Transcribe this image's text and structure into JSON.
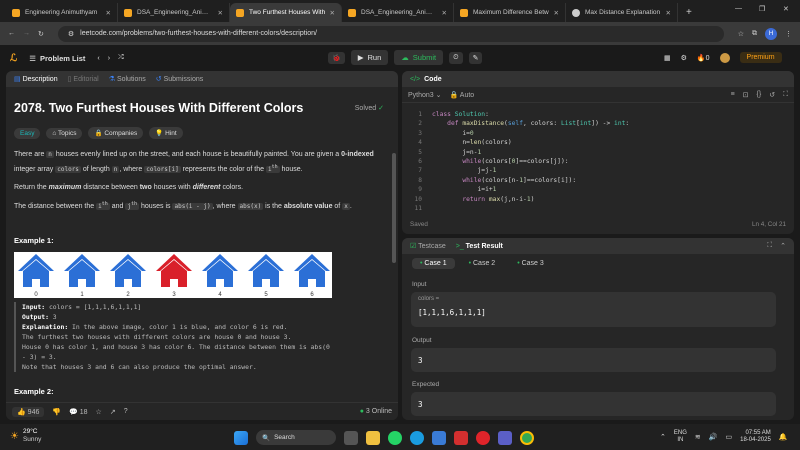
{
  "browser": {
    "tabs": [
      {
        "label": "Engineering Animuthyam"
      },
      {
        "label": "DSA_Engineering_Animuth"
      },
      {
        "label": "Two Furthest Houses With"
      },
      {
        "label": "DSA_Engineering_Animuth"
      },
      {
        "label": "Maximum Difference Betw"
      },
      {
        "label": "Max Distance Explanation"
      }
    ],
    "active_tab": 2,
    "url": "leetcode.com/problems/two-furthest-houses-with-different-colors/description/",
    "profile_initial": "H"
  },
  "toolbar": {
    "problem_list": "Problem List",
    "run": "Run",
    "submit": "Submit",
    "streak": "0",
    "premium": "Premium"
  },
  "left": {
    "tabs": [
      "Description",
      "Editorial",
      "Solutions",
      "Submissions"
    ],
    "title": "2078. Two Furthest Houses With Different Colors",
    "status": "Solved",
    "chips": [
      "Easy",
      "Topics",
      "Companies",
      "Hint"
    ],
    "p1_a": "There are ",
    "p1_n": "n",
    "p1_b": " houses evenly lined up on the street, and each house is beautifully painted. You are given a ",
    "p1_bold": "0-indexed",
    "p1_c": " integer array ",
    "p1_colors": "colors",
    "p1_d": " of length ",
    "p1_n2": "n",
    "p1_e": ", where ",
    "p1_ci": "colors[i]",
    "p1_f": " represents the color of the ",
    "p1_ith": "i",
    "p1_sup": "th",
    "p1_g": " house.",
    "p2_a": "Return the ",
    "p2_b": "maximum",
    "p2_c": " distance between ",
    "p2_d": "two",
    "p2_e": " houses with ",
    "p2_f": "different",
    "p2_g": " colors.",
    "p3_a": "The distance between the ",
    "p3_i": "i",
    "p3_sup1": "th",
    "p3_and": " and ",
    "p3_j": "j",
    "p3_sup2": "th",
    "p3_b": " houses is ",
    "p3_abs": "abs(i - j)",
    "p3_c": ", where ",
    "p3_absx": "abs(x)",
    "p3_d": " is the ",
    "p3_bold": "absolute value",
    "p3_e": " of ",
    "p3_x": "x",
    "p3_f": ".",
    "example1": "Example 1:",
    "house_labels": [
      "0",
      "1",
      "2",
      "3",
      "4",
      "5",
      "6"
    ],
    "house_colors": [
      "#2b6fd6",
      "#2b6fd6",
      "#2b6fd6",
      "#d9202a",
      "#2b6fd6",
      "#2b6fd6",
      "#2b6fd6"
    ],
    "ex_input_label": "Input:",
    "ex_input": " colors = [1,1,1,6,1,1,1]",
    "ex_output_label": "Output:",
    "ex_output": " 3",
    "ex_expl_label": "Explanation:",
    "ex_expl": " In the above image, color 1 is blue, and color 6 is red.",
    "ex_l2": "The furthest two houses with different colors are house 0 and house 3.",
    "ex_l3": "House 0 has color 1, and house 3 has color 6. The distance between them is abs(0",
    "ex_l4": "- 3) = 3.",
    "ex_l5": "Note that houses 3 and 6 can also produce the optimal answer.",
    "example2": "Example 2:",
    "likes": "946",
    "comments": "18",
    "online": "3 Online"
  },
  "code": {
    "header": "Code",
    "language": "Python3",
    "auto": "Auto",
    "line_numbers": [
      "1",
      "2",
      "3",
      "4",
      "5",
      "6",
      "7",
      "8",
      "9",
      "10",
      "11"
    ],
    "saved": "Saved",
    "cursor": "Ln 4, Col 21"
  },
  "testpanel": {
    "tabs": [
      "Testcase",
      "Test Result"
    ],
    "cases": [
      "Case 1",
      "Case 2",
      "Case 3"
    ],
    "input_label": "Input",
    "var_name": "colors =",
    "var_value": "[1,1,1,6,1,1,1]",
    "output_label": "Output",
    "output_value": "3",
    "expected_label": "Expected",
    "expected_value": "3"
  },
  "taskbar": {
    "temp": "29°C",
    "weather": "Sunny",
    "search": "Search",
    "lang": "ENG",
    "region": "IN",
    "time": "07:55 AM",
    "date": "18-04-2025"
  }
}
